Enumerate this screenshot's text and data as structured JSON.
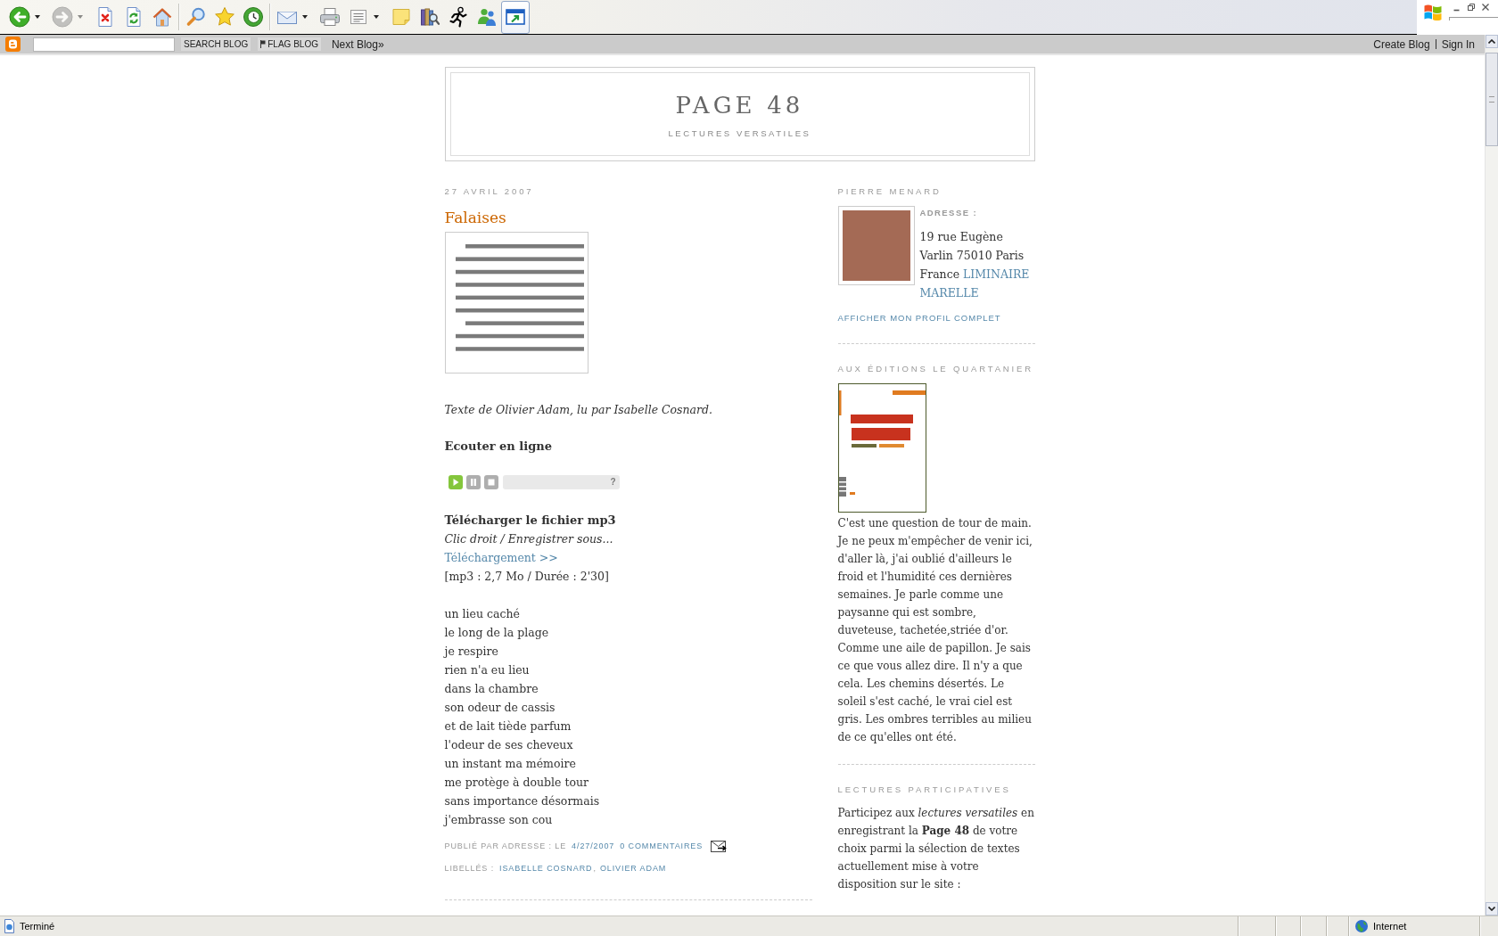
{
  "toolbar": {
    "groups": [
      [
        {
          "kind": "back",
          "dropdown": true,
          "disabled": false,
          "selected": false
        },
        {
          "kind": "forward",
          "dropdown": true,
          "disabled": true,
          "selected": false
        },
        {
          "kind": "stop",
          "dropdown": false,
          "disabled": false,
          "selected": false
        },
        {
          "kind": "refresh",
          "dropdown": false,
          "disabled": false,
          "selected": false
        },
        {
          "kind": "home",
          "dropdown": false,
          "disabled": false,
          "selected": false
        }
      ],
      [
        {
          "kind": "search",
          "dropdown": false,
          "disabled": false,
          "selected": false
        },
        {
          "kind": "favorites",
          "dropdown": false,
          "disabled": false,
          "selected": false
        },
        {
          "kind": "history",
          "dropdown": false,
          "disabled": false,
          "selected": false
        }
      ],
      [
        {
          "kind": "mail",
          "dropdown": true,
          "disabled": false,
          "selected": false
        },
        {
          "kind": "print",
          "dropdown": false,
          "disabled": false,
          "selected": false
        },
        {
          "kind": "edit",
          "dropdown": true,
          "disabled": false,
          "selected": false
        },
        {
          "kind": "note",
          "dropdown": false,
          "disabled": false,
          "selected": false
        },
        {
          "kind": "research",
          "dropdown": false,
          "disabled": false,
          "selected": false
        },
        {
          "kind": "runner",
          "dropdown": false,
          "disabled": false,
          "selected": false
        },
        {
          "kind": "messenger",
          "dropdown": false,
          "disabled": false,
          "selected": false
        },
        {
          "kind": "window",
          "dropdown": false,
          "disabled": false,
          "selected": true
        }
      ]
    ]
  },
  "navbar": {
    "search_button": "SEARCH BLOG",
    "flag_button": "FLAG BLOG",
    "next_link": "Next Blog»",
    "links": [
      "Create Blog",
      "Sign In"
    ]
  },
  "header": {
    "title": "PAGE 48",
    "description": "LECTURES VERSATILES"
  },
  "post": {
    "date": "27 AVRIL 2007",
    "title": "Falaises",
    "credit": "Texte de Olivier Adam, lu par Isabelle Cosnard.",
    "listen_heading": "Ecouter en ligne",
    "player": {
      "help": "?"
    },
    "download": {
      "heading": "Télécharger le fichier mp3",
      "hint": "Clic droit / Enregistrer sous...",
      "link": "Téléchargement >>",
      "info": "[mp3 : 2,7 Mo / Durée : 2'30]"
    },
    "poem": [
      "un lieu caché",
      "le long de la plage",
      "je respire",
      "rien n'a eu lieu",
      "dans la chambre",
      "son odeur de cassis",
      "et de lait tiède parfum",
      "l'odeur de ses cheveux",
      "un instant ma mémoire",
      "me protège à double tour",
      "sans importance désormais",
      "j'embrasse son cou"
    ],
    "footer": {
      "published": "PUBLIÉ PAR ADRESSE : LE",
      "date_link": "4/27/2007",
      "comments_link": "0 COMMENTAIRES",
      "labels_prefix": "LIBELLÉS :",
      "labels": [
        "ISABELLE COSNARD",
        "OLIVIER ADAM"
      ],
      "labels_separator": ","
    }
  },
  "sidebar": {
    "profile": {
      "heading": "PIERRE MENARD",
      "name": "ADRESSE :",
      "about": "19 rue Eugène Varlin 75010 Paris France",
      "links": [
        "LIMINAIRE",
        "MARELLE"
      ],
      "profile_link": "AFFICHER MON PROFIL COMPLET"
    },
    "sections": [
      {
        "kind": "book",
        "heading": "AUX ÉDITIONS LE QUARTANIER",
        "text": "C'est une question de tour de main. Je ne peux m'empêcher de venir ici, d'aller là, j'ai oublié d'ailleurs le froid et l'humidité ces dernières semaines. Je parle comme une paysanne qui est sombre, duveteuse, tachetée,striée d'or. Comme une aile de papillon. Je sais ce que vous allez dire. Il n'y a que cela. Les chemins désertés. Le soleil s'est caché, le vrai ciel est gris. Les ombres terribles au milieu de ce qu'elles ont été."
      },
      {
        "kind": "text",
        "heading": "LECTURES PARTICIPATIVES",
        "text": "Participez aux *lectures versatiles* en enregistrant la **Page 48** de votre choix parmi la sélection de textes actuellement mise à votre disposition sur le site :"
      }
    ]
  },
  "status_bar": {
    "status": "Terminé",
    "zone": "Internet"
  }
}
